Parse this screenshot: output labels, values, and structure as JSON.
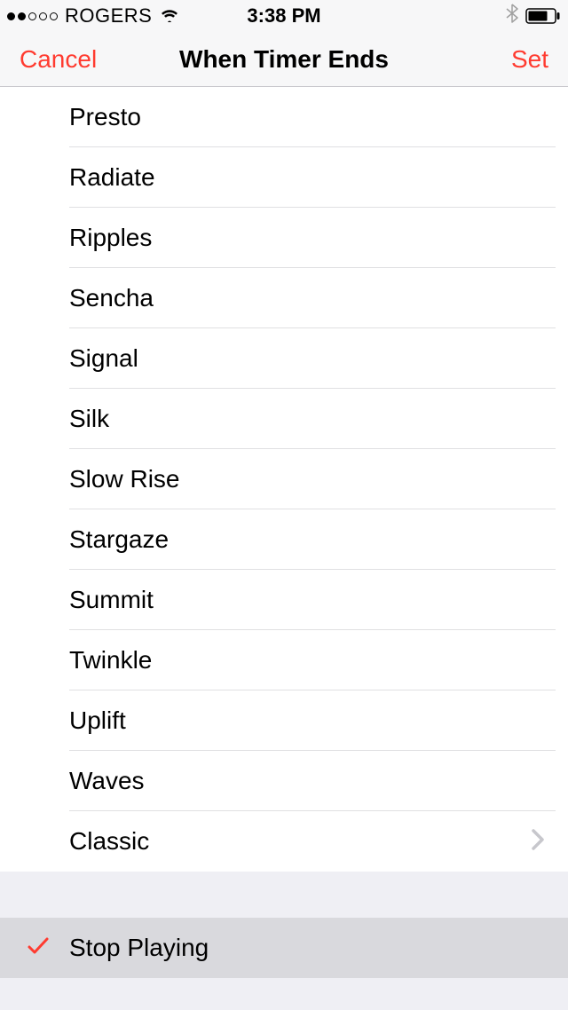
{
  "status": {
    "carrier": "ROGERS",
    "time": "3:38 PM"
  },
  "nav": {
    "cancel": "Cancel",
    "title": "When Timer Ends",
    "set": "Set"
  },
  "sounds": [
    "Presto",
    "Radiate",
    "Ripples",
    "Sencha",
    "Signal",
    "Silk",
    "Slow Rise",
    "Stargaze",
    "Summit",
    "Twinkle",
    "Uplift",
    "Waves",
    "Classic"
  ],
  "stop_playing": "Stop Playing",
  "colors": {
    "accent": "#ff3b30"
  }
}
